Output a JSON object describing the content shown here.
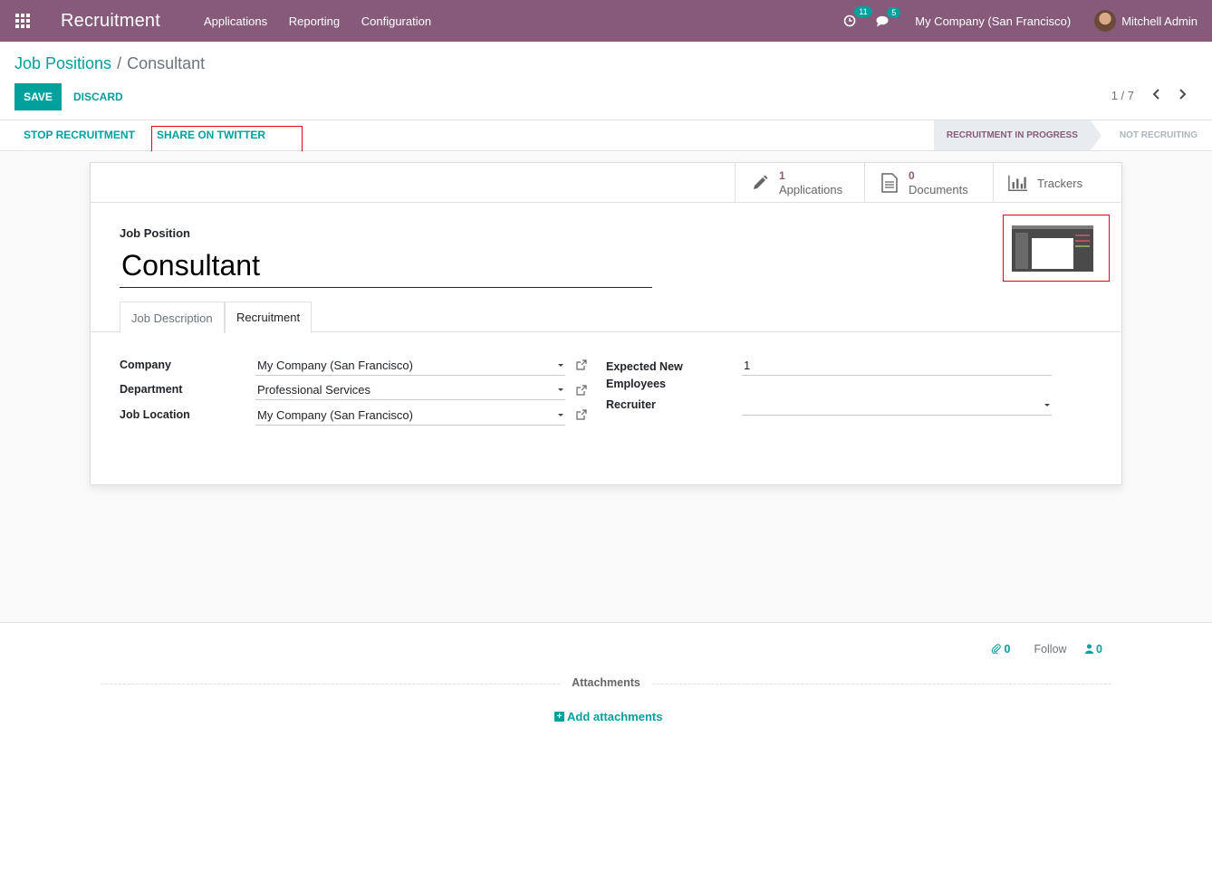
{
  "navbar": {
    "app_name": "Recruitment",
    "menu": [
      "Applications",
      "Reporting",
      "Configuration"
    ],
    "activity_count": "11",
    "messages_count": "5",
    "company": "My Company (San Francisco)",
    "user": "Mitchell Admin",
    "color": "#875a7b"
  },
  "breadcrumb": {
    "parent": "Job Positions",
    "separator": "/",
    "current": "Consultant"
  },
  "actions": {
    "save": "SAVE",
    "discard": "DISCARD"
  },
  "pager": {
    "text": "1 / 7"
  },
  "statusbar": {
    "stop_recruitment": "STOP RECRUITMENT",
    "share_twitter": "SHARE ON TWITTER",
    "stage_active": "RECRUITMENT IN PROGRESS",
    "stage_inactive": "NOT RECRUITING"
  },
  "stat_buttons": {
    "applications_value": "1",
    "applications_label": "Applications",
    "documents_value": "0",
    "documents_label": "Documents",
    "trackers_label": "Trackers"
  },
  "form": {
    "job_position_label": "Job Position",
    "job_position_value": "Consultant",
    "tabs": [
      "Job Description",
      "Recruitment"
    ],
    "company_label": "Company",
    "company_value": "My Company (San Francisco)",
    "department_label": "Department",
    "department_value": "Professional Services",
    "job_location_label": "Job Location",
    "job_location_value": "My Company (San Francisco)",
    "expected_label_1": "Expected New",
    "expected_label_2": "Employees",
    "expected_value": "1",
    "recruiter_label": "Recruiter",
    "recruiter_value": ""
  },
  "chatter": {
    "attachments_count": "0",
    "follow": "Follow",
    "followers_count": "0",
    "attachments_title": "Attachments",
    "add_attachments": "Add attachments"
  },
  "colors": {
    "brand": "#875a7b",
    "accent": "#00a09d",
    "highlight": "#e0001b"
  }
}
